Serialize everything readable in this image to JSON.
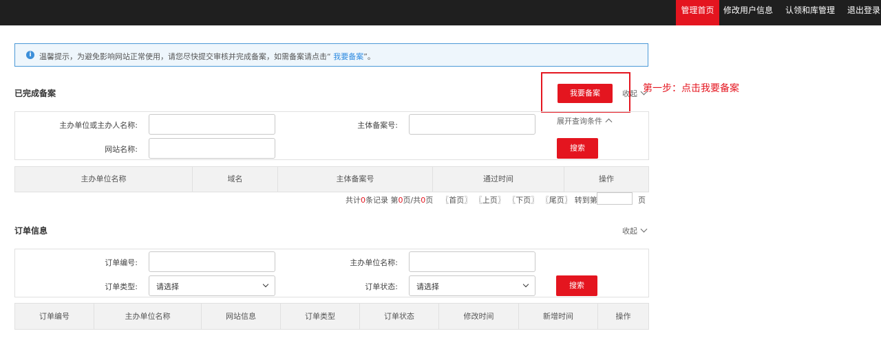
{
  "topnav": {
    "items": [
      {
        "label": "管理首页",
        "active": true
      },
      {
        "label": "修改用户信息"
      },
      {
        "label": "认领和库管理"
      },
      {
        "label": "退出登录"
      }
    ]
  },
  "notice": {
    "text": "温馨提示，为避免影响网站正常使用，请您尽快提交审核并完成备案，如需备案请点击“",
    "link": " 我要备案",
    "suffix": "”。"
  },
  "completed": {
    "title": "已完成备案",
    "apply_button": "我要备案",
    "collapse_label": "收起",
    "expand_label": "展开查询条件",
    "search_button": "搜索",
    "filters": {
      "org_label": "主办单位或主办人名称:",
      "record_label": "主体备案号:",
      "site_label": "网站名称:"
    },
    "columns": [
      "主办单位名称",
      "域名",
      "主体备案号",
      "通过时间",
      "操作"
    ],
    "pager": {
      "total_prefix": "共计",
      "total": "0",
      "total_suffix": "条记录 第",
      "page": "0",
      "page_mid": "页/共",
      "pages": "0",
      "page_suffix": "页",
      "first": "〖首页〗",
      "prev": "〖上页〗",
      "next": "〖下页〗",
      "last": "〖尾页〗",
      "goto": "转到第",
      "goto_suffix": "页"
    }
  },
  "annotation": {
    "text": "第一步：点击我要备案",
    "color": "#e4151f"
  },
  "orders": {
    "title": "订单信息",
    "collapse_label": "收起",
    "search_button": "搜索",
    "filters": {
      "order_no_label": "订单编号:",
      "org_name_label": "主办单位名称:",
      "order_type_label": "订单类型:",
      "order_type_value": "请选择",
      "order_status_label": "订单状态:",
      "order_status_value": "请选择"
    },
    "columns": [
      "订单编号",
      "主办单位名称",
      "网站信息",
      "订单类型",
      "订单状态",
      "修改时间",
      "新增时间",
      "操作"
    ]
  },
  "colors": {
    "accent": "#e4151f",
    "topbar": "#1f1f1f",
    "notice_border": "#4a98d6",
    "link": "#2f8be0"
  }
}
